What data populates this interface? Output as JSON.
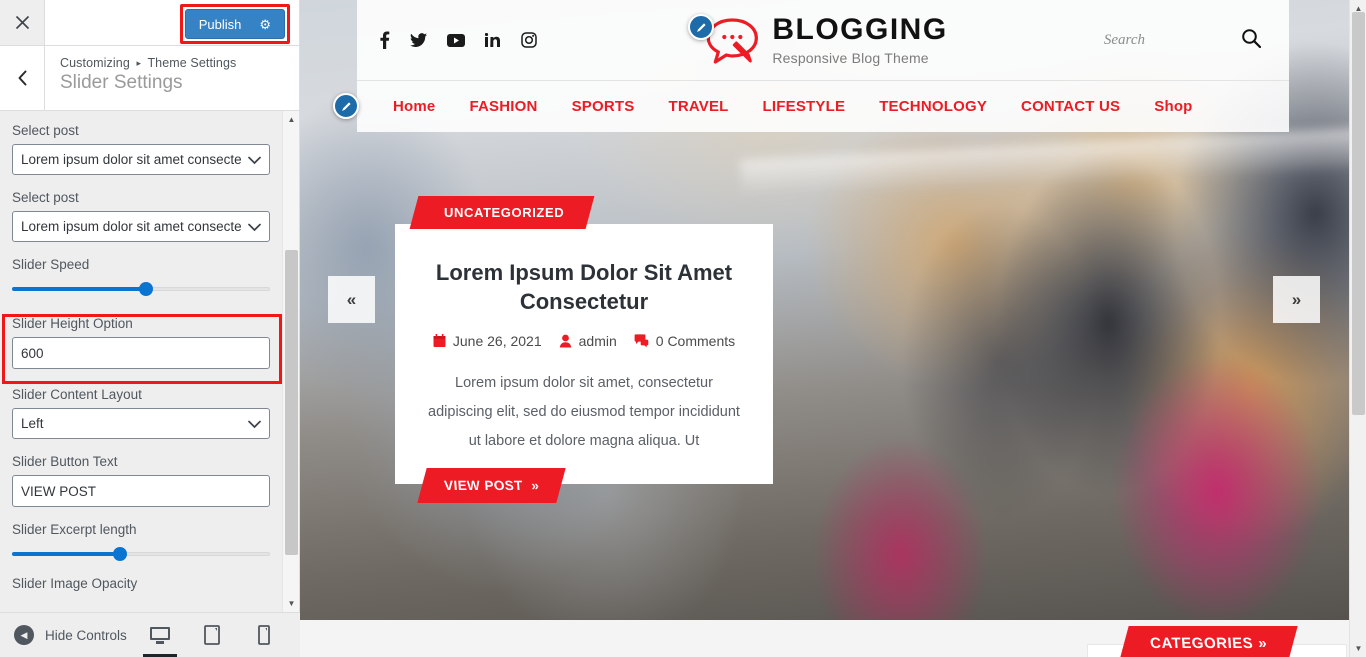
{
  "customizer": {
    "close_icon": "close-icon",
    "publish_label": "Publish",
    "gear_icon": "gear-icon",
    "back_icon": "chevron-left-icon",
    "breadcrumb_root": "Customizing",
    "breadcrumb_sep": "▸",
    "breadcrumb_parent": "Theme Settings",
    "panel_title": "Slider Settings",
    "accent_highlight": "#f11717",
    "publish_bg": "#3582c4",
    "controls": [
      {
        "label": "Select post",
        "type": "select",
        "value": "Lorem ipsum dolor sit amet consecte"
      },
      {
        "label": "Select post",
        "type": "select",
        "value": "Lorem ipsum dolor sit amet consecte"
      },
      {
        "label": "Slider Speed",
        "type": "range",
        "percent": 52
      },
      {
        "label": "Slider Height Option",
        "type": "text",
        "value": "600",
        "highlighted": true
      },
      {
        "label": "Slider Content Layout",
        "type": "select",
        "value": "Left"
      },
      {
        "label": "Slider Button Text",
        "type": "text",
        "value": "VIEW POST"
      },
      {
        "label": "Slider Excerpt length",
        "type": "range",
        "percent": 42
      },
      {
        "label": "Slider Image Opacity",
        "type": "cutoff"
      }
    ],
    "footer": {
      "hide_controls_label": "Hide Controls",
      "hide_controls_icon": "collapse-left-icon",
      "devices": [
        {
          "name": "desktop-icon",
          "active": true
        },
        {
          "name": "tablet-icon",
          "active": false
        },
        {
          "name": "mobile-icon",
          "active": false
        }
      ]
    },
    "scrollbar": {
      "up_arrow": "▲",
      "down_arrow": "▼"
    }
  },
  "preview": {
    "header": {
      "socials": [
        "facebook-icon",
        "twitter-icon",
        "youtube-icon",
        "linkedin-icon",
        "instagram-icon"
      ],
      "brand_title": "BLOGGING",
      "brand_tagline": "Responsive Blog Theme",
      "search_placeholder": "Search",
      "search_icon": "search-icon",
      "edit_icon": "pencil-edit-icon"
    },
    "nav": {
      "items": [
        "Home",
        "FASHION",
        "SPORTS",
        "TRAVEL",
        "LIFESTYLE",
        "TECHNOLOGY",
        "CONTACT US",
        "Shop"
      ],
      "accent_color": "#ed1c24"
    },
    "slide": {
      "category": "UNCATEGORIZED",
      "title": "Lorem Ipsum Dolor Sit Amet Consectetur",
      "date": "June 26, 2021",
      "date_icon": "calendar-icon",
      "author": "admin",
      "author_icon": "user-icon",
      "comments": "0 Comments",
      "comments_icon": "comment-icon",
      "excerpt": "Lorem ipsum dolor sit amet, consectetur adipiscing elit, sed do eiusmod tempor incididunt ut labore et dolore magna aliqua. Ut",
      "button_label": "VIEW POST",
      "button_chevron": "»",
      "prev_arrow": "«",
      "next_arrow": "»"
    },
    "footer_widget": {
      "categories_label": "CATEGORIES",
      "categories_chevron": "»"
    },
    "scrollbar": {
      "up_arrow": "▲",
      "down_arrow": "▼"
    }
  }
}
